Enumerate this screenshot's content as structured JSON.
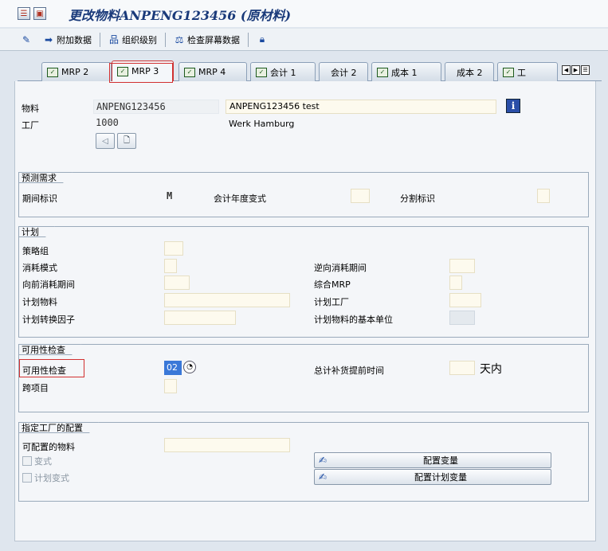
{
  "header": {
    "title": "更改物料ANPENG123456 (原材料)"
  },
  "toolbar": {
    "items": [
      {
        "label": "附加数据",
        "icon": "arrow-right-icon"
      },
      {
        "label": "组织级别",
        "icon": "org-structure-icon"
      },
      {
        "label": "检查屏幕数据",
        "icon": "check-screen-icon"
      }
    ]
  },
  "tabs": [
    "MRP 2",
    "MRP 3",
    "MRP 4",
    "会计 1",
    "会计 2",
    "成本 1",
    "成本 2",
    "工"
  ],
  "active_tab": "MRP 3",
  "material": {
    "material_label": "物料",
    "material_value": "ANPENG123456",
    "material_desc": "ANPENG123456 test",
    "plant_label": "工厂",
    "plant_value": "1000",
    "plant_name": "Werk Hamburg"
  },
  "forecast": {
    "title": "预测需求",
    "period_label": "期间标识",
    "period_value": "M",
    "fiscal_label": "会计年度变式",
    "split_label": "分割标识"
  },
  "planning": {
    "title": "计划",
    "strategy_group": "策略组",
    "consumption_mode": "消耗模式",
    "backward_period": "逆向消耗期间",
    "forward_period": "向前消耗期间",
    "mixed_mrp": "综合MRP",
    "planning_material": "计划物料",
    "planning_plant": "计划工厂",
    "conversion_factor": "计划转换因子",
    "base_unit": "计划物料的基本单位"
  },
  "availability": {
    "title": "可用性检查",
    "check_label": "可用性检查",
    "check_value": "02",
    "total_replenishment": "总计补货提前时间",
    "days_unit": "天内",
    "cross_project": "跨项目"
  },
  "plant_config": {
    "title": "指定工厂的配置",
    "configurable_material": "可配置的物料",
    "variant_label": "变式",
    "planning_variant_label": "计划变式",
    "config_variant_btn": "配置变量",
    "config_planning_variant_btn": "配置计划变量"
  }
}
